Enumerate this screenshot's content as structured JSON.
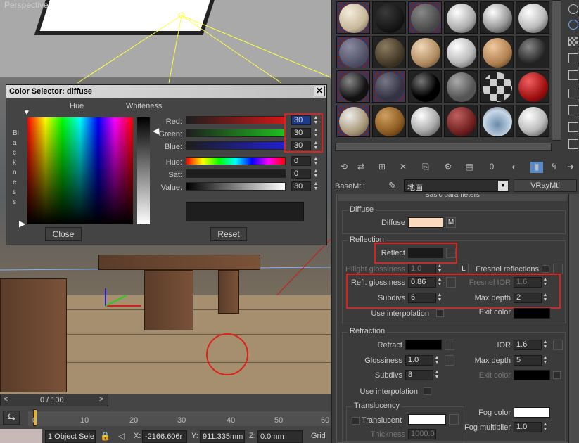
{
  "viewport": {
    "label": "Perspective"
  },
  "color_dialog": {
    "title": "Color Selector: diffuse",
    "hue_label": "Hue",
    "whiteness_label": "Whiteness",
    "blackness_label": "Blackness",
    "rows": [
      {
        "label": "Red:",
        "value": "30"
      },
      {
        "label": "Green:",
        "value": "30"
      },
      {
        "label": "Blue:",
        "value": "30"
      },
      {
        "label": "Hue:",
        "value": "0"
      },
      {
        "label": "Sat:",
        "value": "0"
      },
      {
        "label": "Value:",
        "value": "30"
      }
    ],
    "close_label": "Close",
    "reset_label": "Reset"
  },
  "material_editor": {
    "basemtl_label": "BaseMtl:",
    "material_name": "地面",
    "material_type": "VRayMtl",
    "rollout_title": "Basic parameters",
    "toolbar_number": "0",
    "diffuse": {
      "group_title": "Diffuse",
      "label": "Diffuse",
      "map_label": "M",
      "color": "#fbd9bd"
    },
    "reflection": {
      "group_title": "Reflection",
      "reflect_label": "Reflect",
      "reflect_color": "#1a1a1a",
      "hilight_label": "Hilight glossiness",
      "hilight_value": "1.0",
      "hilight_lock": "L",
      "fresnel_label": "Fresnel reflections",
      "refl_gloss_label": "Refl. glossiness",
      "refl_gloss_value": "0.86",
      "fresnel_ior_label": "Fresnel IOR",
      "fresnel_ior_value": "1.6",
      "subdivs_label": "Subdivs",
      "subdivs_value": "6",
      "max_depth_label": "Max depth",
      "max_depth_value": "2",
      "use_interp_label": "Use interpolation",
      "exit_color_label": "Exit color"
    },
    "refraction": {
      "group_title": "Refraction",
      "refract_label": "Refract",
      "ior_label": "IOR",
      "ior_value": "1.6",
      "gloss_label": "Glossiness",
      "gloss_value": "1.0",
      "max_depth_label": "Max depth",
      "max_depth_value": "5",
      "subdivs_label": "Subdivs",
      "subdivs_value": "8",
      "exit_color_label": "Exit color",
      "use_interp_label": "Use interpolation",
      "translucency_title": "Translucency",
      "translucent_label": "Translucent",
      "fog_color_label": "Fog color",
      "fog_mult_label": "Fog multiplier",
      "fog_mult_value": "1.0",
      "thickness_label": "Thickness",
      "thickness_value": "1000.0"
    }
  },
  "timeline": {
    "frame_counter": "0 / 100",
    "ticks": [
      "0",
      "10",
      "20",
      "30",
      "40",
      "50",
      "60"
    ],
    "objects_selected": "1 Object Sele",
    "x_label": "X:",
    "x_value": "-2166.606r",
    "y_label": "Y:",
    "y_value": "911.335mm",
    "z_label": "Z:",
    "z_value": "0.0mm",
    "grid_label": "Grid"
  }
}
